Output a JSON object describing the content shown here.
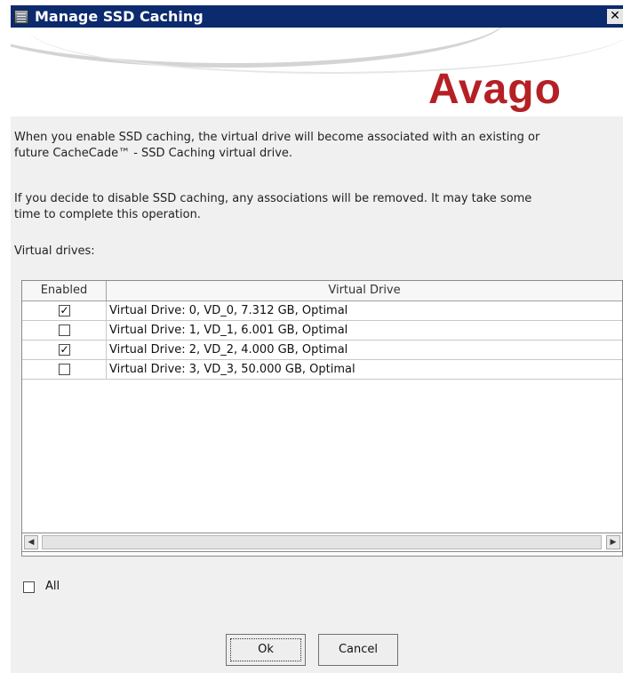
{
  "window": {
    "title": "Manage SSD Caching",
    "close_glyph": "✕",
    "app_icon": "server-icon",
    "close_icon": "close-icon"
  },
  "banner": {
    "logo_text": "Avago",
    "logo_color": "#b52025"
  },
  "description": {
    "line1": "When you enable SSD caching, the virtual drive will become associated with an existing or",
    "line2": "future CacheCade™ - SSD Caching virtual drive.",
    "line3": "If you decide to disable SSD caching, any associations will be removed. It may take some",
    "line4": "time to complete this operation."
  },
  "table": {
    "label": "Virtual drives:",
    "columns": [
      "Enabled",
      "Virtual Drive"
    ],
    "rows": [
      {
        "enabled": true,
        "text": "Virtual Drive: 0, VD_0, 7.312 GB, Optimal"
      },
      {
        "enabled": false,
        "text": "Virtual Drive: 1, VD_1, 6.001 GB, Optimal"
      },
      {
        "enabled": true,
        "text": "Virtual Drive: 2, VD_2, 4.000 GB, Optimal"
      },
      {
        "enabled": false,
        "text": "Virtual Drive: 3, VD_3, 50.000 GB, Optimal"
      }
    ],
    "check_glyph": "✓"
  },
  "scrollbar": {
    "left_glyph": "◀",
    "right_glyph": "▶"
  },
  "select_all": {
    "label": "All",
    "checked": false
  },
  "buttons": {
    "ok": "Ok",
    "cancel": "Cancel"
  }
}
